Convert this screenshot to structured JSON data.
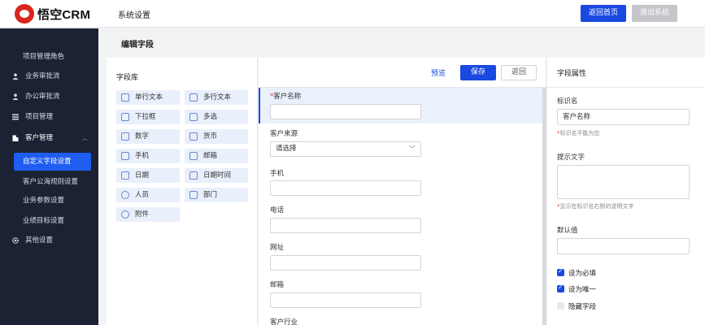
{
  "header": {
    "logo_text": "悟空CRM",
    "page_title": "系统设置",
    "home_button": "返回首页",
    "logout_button": "退出系统",
    "accent": "#1a49e0"
  },
  "sidebar": {
    "items": [
      {
        "label": "项目管理角色",
        "icon": ""
      },
      {
        "label": "业务审批流",
        "icon": "user-icon"
      },
      {
        "label": "办公审批流",
        "icon": "user-icon"
      },
      {
        "label": "项目管理",
        "icon": "list-icon"
      },
      {
        "label": "客户管理",
        "icon": "building-icon"
      },
      {
        "label": "自定义字段设置",
        "icon": ""
      },
      {
        "label": "客户公海规则设置",
        "icon": ""
      },
      {
        "label": "业务参数设置",
        "icon": ""
      },
      {
        "label": "业绩目标设置",
        "icon": ""
      },
      {
        "label": "其他设置",
        "icon": "gear-icon"
      }
    ]
  },
  "main": {
    "title": "编辑字段"
  },
  "library": {
    "title": "字段库",
    "fields": [
      "单行文本",
      "多行文本",
      "下拉框",
      "多选",
      "数字",
      "货币",
      "手机",
      "邮箱",
      "日期",
      "日期时间",
      "人员",
      "部门",
      "附件"
    ]
  },
  "form": {
    "preview_label": "预览",
    "save_label": "保存",
    "back_label": "返回",
    "fields": [
      {
        "label": "客户名称",
        "required": "*",
        "value": ""
      },
      {
        "label": "客户来源",
        "value": "请选择"
      },
      {
        "label": "手机",
        "value": ""
      },
      {
        "label": "电话",
        "value": ""
      },
      {
        "label": "网址",
        "value": ""
      },
      {
        "label": "邮箱",
        "value": ""
      },
      {
        "label": "客户行业"
      }
    ]
  },
  "props": {
    "title": "字段属性",
    "id_label": "标识名",
    "id_value": "客户名称",
    "id_hint": "标识名不能为空",
    "tip_label": "提示文字",
    "tip_hint": "显示在标识名右侧的说明文字",
    "default_label": "默认值",
    "required_label": "设为必填",
    "unique_label": "设为唯一",
    "hidden_label": "隐藏字段"
  }
}
